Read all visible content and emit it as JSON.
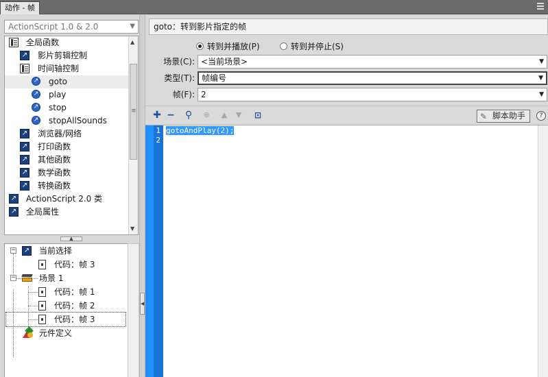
{
  "window": {
    "tab_title": "动作 - 帧"
  },
  "left_panel": {
    "version_dropdown": "ActionScript 1.0 & 2.0",
    "toolbox": [
      {
        "label": "全局函数",
        "icon": "book-icon"
      },
      {
        "label": "影片剪辑控制",
        "icon": "action-box-icon"
      },
      {
        "label": "时间轴控制",
        "icon": "book-icon"
      },
      {
        "label": "goto",
        "icon": "action-circle-icon"
      },
      {
        "label": "play",
        "icon": "action-circle-icon"
      },
      {
        "label": "stop",
        "icon": "action-circle-icon"
      },
      {
        "label": "stopAllSounds",
        "icon": "action-circle-icon"
      },
      {
        "label": "浏览器/网络",
        "icon": "action-box-icon"
      },
      {
        "label": "打印函数",
        "icon": "action-box-icon"
      },
      {
        "label": "其他函数",
        "icon": "action-box-icon"
      },
      {
        "label": "数学函数",
        "icon": "action-box-icon"
      },
      {
        "label": "转换函数",
        "icon": "action-box-icon"
      },
      {
        "label": "ActionScript 2.0 类",
        "icon": "action-box-icon"
      },
      {
        "label": "全局属性",
        "icon": "action-box-icon"
      }
    ],
    "script_navigator": [
      {
        "label": "当前选择",
        "icon": "action-box-icon",
        "expander": "−"
      },
      {
        "label": "代码：帧 3",
        "icon": "frame-icon"
      },
      {
        "label": "场景 1",
        "icon": "scene-icon",
        "expander": "−"
      },
      {
        "label": "代码：帧 1",
        "icon": "frame-icon"
      },
      {
        "label": "代码：帧 2",
        "icon": "frame-icon"
      },
      {
        "label": "代码：帧 3",
        "icon": "frame-icon"
      },
      {
        "label": "元件定义",
        "icon": "symbol-icon"
      }
    ]
  },
  "right_panel": {
    "description": "goto：转到影片指定的帧",
    "radio_play": "转到并播放(P)",
    "radio_stop": "转到并停止(S)",
    "scene_label": "场景(C):",
    "scene_value": "<当前场景>",
    "type_label": "类型(T):",
    "type_value": "帧编号",
    "frame_label": "帧(F):",
    "frame_value": "2",
    "script_assist": "脚本助手",
    "help": "?"
  },
  "editor": {
    "line_numbers": [
      "1",
      "2"
    ],
    "lines": [
      "gotoAndPlay(2);",
      ""
    ]
  }
}
